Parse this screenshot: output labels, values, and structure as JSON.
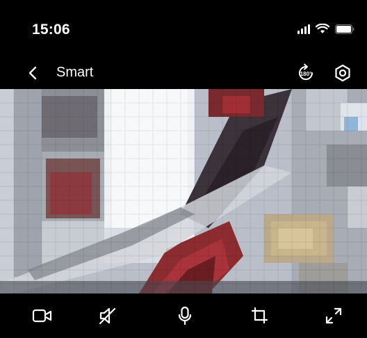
{
  "status_bar": {
    "time": "15:06",
    "icons": [
      "signal-icon",
      "wifi-icon",
      "battery-icon"
    ]
  },
  "nav": {
    "title": "Smart",
    "back_icon": "chevron-left-icon",
    "rotate_icon": "rotate-180-icon",
    "rotate_label": "180°",
    "settings_icon": "settings-icon"
  },
  "video": {
    "description_icon": "camera-live-feed"
  },
  "toolbar": {
    "items": [
      {
        "icon": "video-record-icon"
      },
      {
        "icon": "speaker-mute-icon"
      },
      {
        "icon": "microphone-icon"
      },
      {
        "icon": "crop-icon"
      },
      {
        "icon": "fullscreen-icon"
      }
    ]
  },
  "colors": {
    "background": "#000000",
    "foreground": "#ffffff"
  }
}
